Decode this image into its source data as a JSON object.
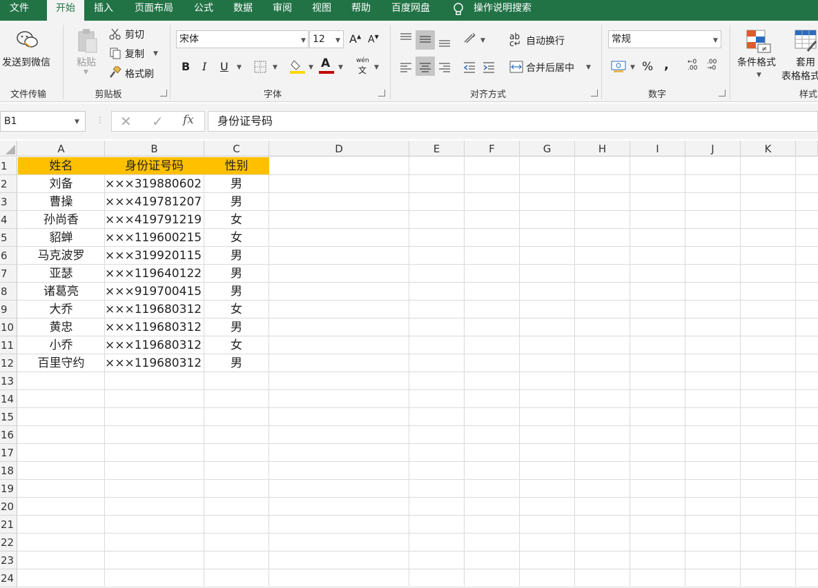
{
  "menu": {
    "tabs": [
      "文件",
      "开始",
      "插入",
      "页面布局",
      "公式",
      "数据",
      "审阅",
      "视图",
      "帮助",
      "百度网盘"
    ],
    "active_tab": "开始",
    "search_label": "操作说明搜索"
  },
  "ribbon": {
    "groups": {
      "file_transfer": "文件传输",
      "clipboard": "剪贴板",
      "font": "字体",
      "alignment": "对齐方式",
      "number": "数字",
      "styles": "样式"
    },
    "send_wechat": "发送到微信",
    "paste": "粘贴",
    "cut": "剪切",
    "copy": "复制",
    "format_painter": "格式刷",
    "font_name": "宋体",
    "font_size": "12",
    "bold": "B",
    "italic": "I",
    "underline": "U",
    "wrap_text": "自动换行",
    "merge_center": "合并后居中",
    "number_format": "常规",
    "percent": "%",
    "comma": ",",
    "conditional_format": "条件格式",
    "table_format_1": "套用",
    "table_format_2": "表格格式",
    "phonetic": "wén",
    "phonetic_char": "文",
    "fill_color": "#ffd700",
    "font_color": "#c00000"
  },
  "formula_bar": {
    "name_box": "B1",
    "content": "身份证号码",
    "fx": "fx"
  },
  "columns": [
    "A",
    "B",
    "C",
    "D",
    "E",
    "F",
    "G",
    "H",
    "I",
    "J",
    "K"
  ],
  "rows": [
    "1",
    "2",
    "3",
    "4",
    "5",
    "6",
    "7",
    "8",
    "9",
    "10",
    "11",
    "12",
    "13",
    "14",
    "15",
    "16",
    "17",
    "18",
    "19",
    "20",
    "21",
    "22",
    "23",
    "24"
  ],
  "table": {
    "headers": [
      "姓名",
      "身份证号码",
      "性别"
    ],
    "data": [
      [
        "刘备",
        "×××319880602",
        "男"
      ],
      [
        "曹操",
        "×××419781207",
        "男"
      ],
      [
        "孙尚香",
        "×××419791219",
        "女"
      ],
      [
        "貂蝉",
        "×××119600215",
        "女"
      ],
      [
        "马克波罗",
        "×××319920115",
        "男"
      ],
      [
        "亚瑟",
        "×××119640122",
        "男"
      ],
      [
        "诸葛亮",
        "×××919700415",
        "男"
      ],
      [
        "大乔",
        "×××119680312",
        "女"
      ],
      [
        "黄忠",
        "×××119680312",
        "男"
      ],
      [
        "小乔",
        "×××119680312",
        "女"
      ],
      [
        "百里守约",
        "×××119680312",
        "男"
      ]
    ]
  },
  "colors": {
    "excel_green": "#217346",
    "header_fill": "#ffc000"
  }
}
